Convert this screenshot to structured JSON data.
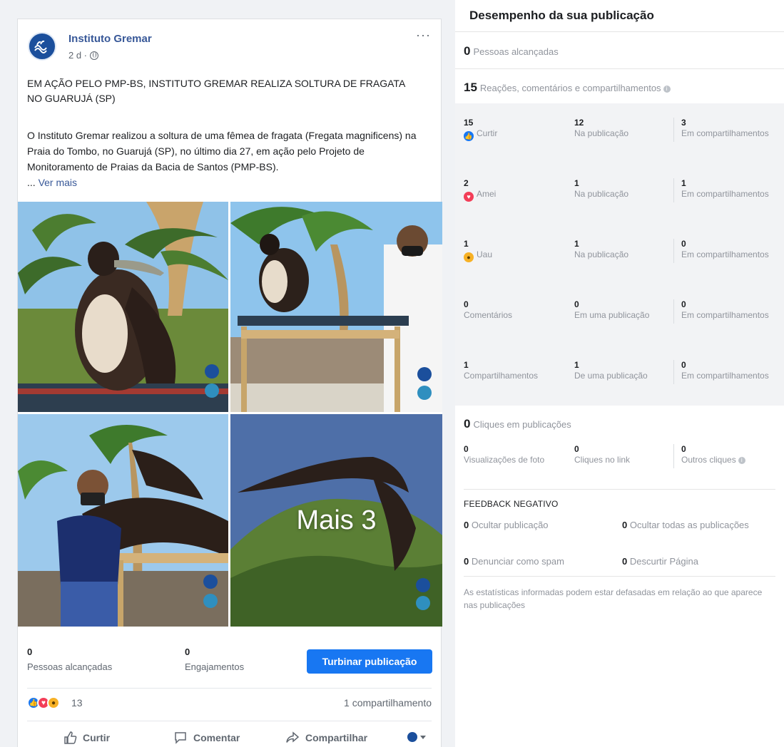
{
  "post": {
    "author": "Instituto Gremar",
    "time": "2 d ·",
    "more": "···",
    "headline": "EM AÇÃO PELO PMP-BS, INSTITUTO GREMAR REALIZA SOLTURA DE FRAGATA NO GUARUJÁ (SP)",
    "body": "O Instituto Gremar realizou a soltura de uma fêmea de fragata (Fregata magnificens) na Praia do Tombo, no Guarujá (SP), no último dia 27, em ação pelo Projeto de Monitoramento de Praias da Bacia de Santos (PMP-BS).",
    "ellipsis": "...",
    "see_more": "Ver mais",
    "more_photos": "Mais 3",
    "stats": {
      "reach_value": "0",
      "reach_label": "Pessoas alcançadas",
      "engagement_value": "0",
      "engagement_label": "Engajamentos"
    },
    "boost_label": "Turbinar publicação",
    "reaction_count": "13",
    "share_count": "1 compartilhamento",
    "actions": {
      "like": "Curtir",
      "comment": "Comentar",
      "share": "Compartilhar"
    }
  },
  "insights": {
    "title": "Desempenho da sua publicação",
    "reach": {
      "value": "0",
      "label": "Pessoas alcançadas"
    },
    "engagement": {
      "value": "15",
      "label": "Reações, comentários e compartilhamentos"
    },
    "rows": [
      {
        "total": "15",
        "label": "Curtir",
        "post": "12",
        "post_label": "Na publicação",
        "shares": "3",
        "shares_label": "Em compartilhamentos"
      },
      {
        "total": "2",
        "label": "Amei",
        "post": "1",
        "post_label": "Na publicação",
        "shares": "1",
        "shares_label": "Em compartilhamentos"
      },
      {
        "total": "1",
        "label": "Uau",
        "post": "1",
        "post_label": "Na publicação",
        "shares": "0",
        "shares_label": "Em compartilhamentos"
      },
      {
        "total": "0",
        "label": "Comentários",
        "post": "0",
        "post_label": "Em uma publicação",
        "shares": "0",
        "shares_label": "Em compartilhamentos"
      },
      {
        "total": "1",
        "label": "Compartilhamentos",
        "post": "1",
        "post_label": "De uma publicação",
        "shares": "0",
        "shares_label": "Em compartilhamentos"
      }
    ],
    "clicks": {
      "value": "0",
      "label": "Cliques em publicações"
    },
    "click_breakdown": [
      {
        "value": "0",
        "label": "Visualizações de foto"
      },
      {
        "value": "0",
        "label": "Cliques no link"
      },
      {
        "value": "0",
        "label": "Outros cliques"
      }
    ],
    "negative_title": "FEEDBACK NEGATIVO",
    "negative": [
      {
        "value": "0",
        "label": "Ocultar publicação"
      },
      {
        "value": "0",
        "label": "Ocultar todas as publicações"
      },
      {
        "value": "0",
        "label": "Denunciar como spam"
      },
      {
        "value": "0",
        "label": "Descurtir Página"
      }
    ],
    "disclaimer": "As estatísticas informadas podem estar defasadas em relação ao que aparece nas publicações"
  },
  "colors": {
    "brand_blue": "#1877f2",
    "link_blue": "#385898",
    "love_red": "#f33e58",
    "wow_yellow": "#f7b125"
  }
}
